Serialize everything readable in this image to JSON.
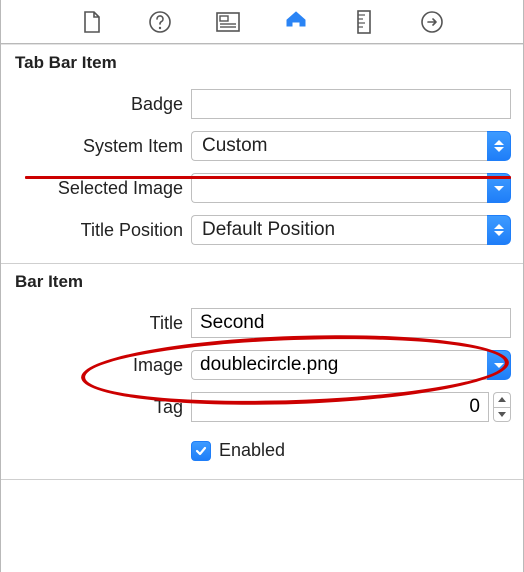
{
  "sections": {
    "tabBarItem": {
      "header": "Tab Bar Item",
      "badge": {
        "label": "Badge",
        "value": ""
      },
      "systemItem": {
        "label": "System Item",
        "value": "Custom"
      },
      "selectedImage": {
        "label": "Selected Image",
        "value": ""
      },
      "titlePosition": {
        "label": "Title Position",
        "value": "Default Position"
      }
    },
    "barItem": {
      "header": "Bar Item",
      "title": {
        "label": "Title",
        "value": "Second"
      },
      "image": {
        "label": "Image",
        "value": "doublecircle.png"
      },
      "tag": {
        "label": "Tag",
        "value": "0"
      },
      "enabled": {
        "label": "Enabled",
        "checked": true
      }
    }
  }
}
